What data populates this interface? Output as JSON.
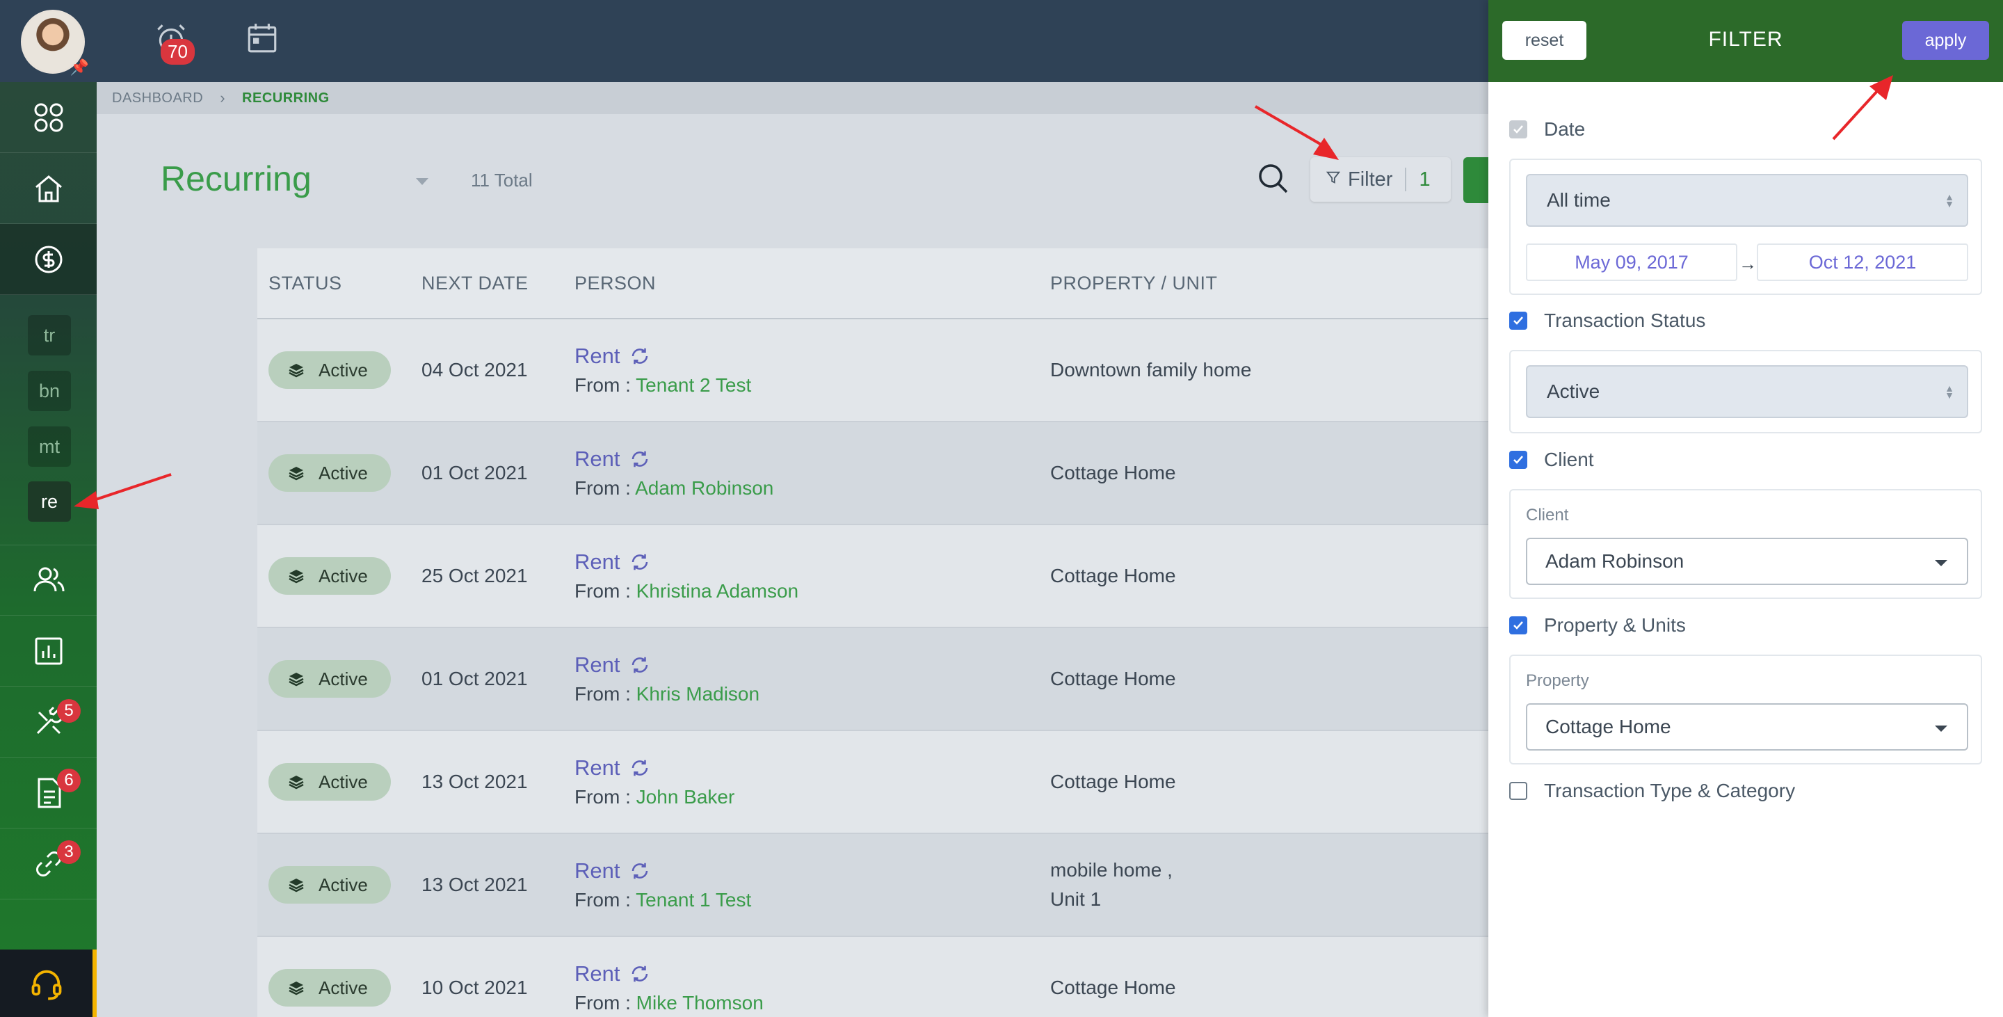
{
  "header": {
    "alarm_count": "70"
  },
  "sidebar": {
    "sub_items": [
      "tr",
      "bn",
      "mt",
      "re"
    ],
    "badges": {
      "tools": "5",
      "documents": "6",
      "links": "3"
    }
  },
  "breadcrumb": {
    "dashboard": "DASHBOARD",
    "current": "RECURRING"
  },
  "main": {
    "title": "Recurring",
    "total": "11 Total",
    "filter_label": "Filter",
    "filter_count": "1"
  },
  "table": {
    "columns": [
      "STATUS",
      "NEXT DATE",
      "PERSON",
      "PROPERTY / UNIT"
    ],
    "rows": [
      {
        "status": "Active",
        "date": "04 Oct 2021",
        "type": "Rent",
        "from_label": "From :",
        "person": "Tenant 2 Test",
        "property": "Downtown family home",
        "unit": ""
      },
      {
        "status": "Active",
        "date": "01 Oct 2021",
        "type": "Rent",
        "from_label": "From :",
        "person": "Adam Robinson",
        "property": "Cottage Home",
        "unit": ""
      },
      {
        "status": "Active",
        "date": "25 Oct 2021",
        "type": "Rent",
        "from_label": "From :",
        "person": "Khristina Adamson",
        "property": "Cottage Home",
        "unit": ""
      },
      {
        "status": "Active",
        "date": "01 Oct 2021",
        "type": "Rent",
        "from_label": "From :",
        "person": "Khris Madison",
        "property": "Cottage Home",
        "unit": ""
      },
      {
        "status": "Active",
        "date": "13 Oct 2021",
        "type": "Rent",
        "from_label": "From :",
        "person": "John Baker",
        "property": "Cottage Home",
        "unit": ""
      },
      {
        "status": "Active",
        "date": "13 Oct 2021",
        "type": "Rent",
        "from_label": "From :",
        "person": "Tenant 1 Test",
        "property": "mobile home ,",
        "unit": "Unit 1"
      },
      {
        "status": "Active",
        "date": "10 Oct 2021",
        "type": "Rent",
        "from_label": "From :",
        "person": "Mike Thomson",
        "property": "Cottage Home",
        "unit": ""
      }
    ]
  },
  "filter": {
    "reset": "reset",
    "title": "FILTER",
    "apply": "apply",
    "date_label": "Date",
    "date_range": "All time",
    "date_from": "May 09, 2017",
    "date_to": "Oct 12, 2021",
    "status_label": "Transaction Status",
    "status_value": "Active",
    "client_label": "Client",
    "client_sublabel": "Client",
    "client_value": "Adam Robinson",
    "property_label": "Property & Units",
    "property_sublabel": "Property",
    "property_value": "Cottage Home",
    "type_label": "Transaction Type & Category"
  },
  "colors": {
    "accent_green": "#3a9c4a",
    "apply_purple": "#6b68d6",
    "panel_header": "#2c6a29",
    "annotation_red": "#e8262a"
  }
}
